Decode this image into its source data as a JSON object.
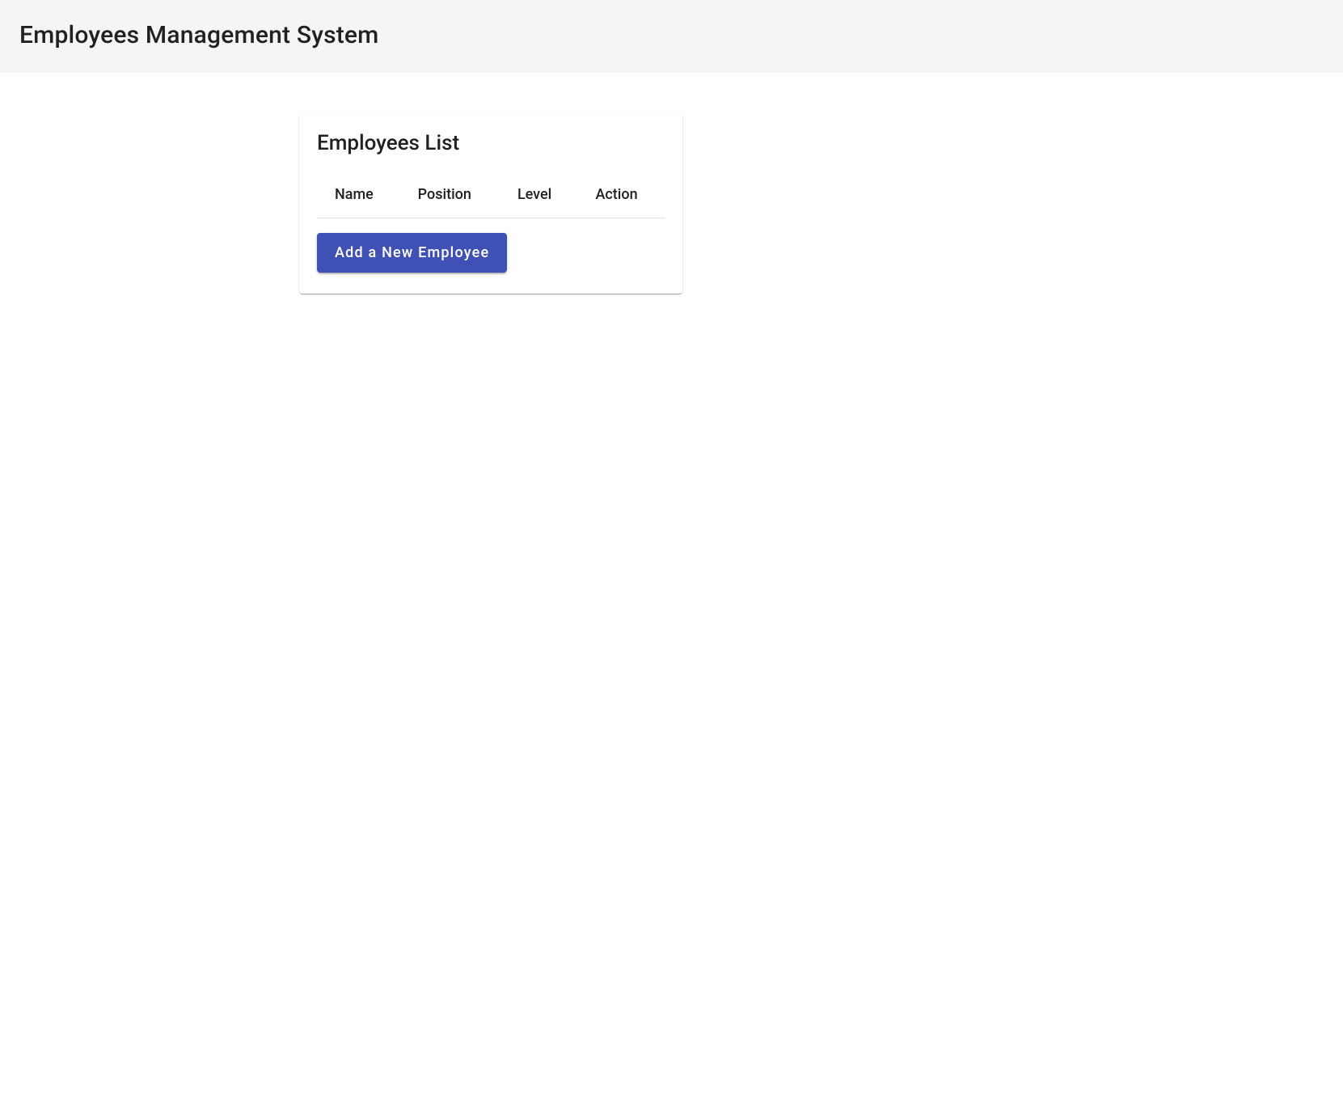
{
  "header": {
    "title": "Employees Management System"
  },
  "card": {
    "title": "Employees List",
    "columns": {
      "name": "Name",
      "position": "Position",
      "level": "Level",
      "action": "Action"
    },
    "add_button_label": "Add a New Employee"
  }
}
